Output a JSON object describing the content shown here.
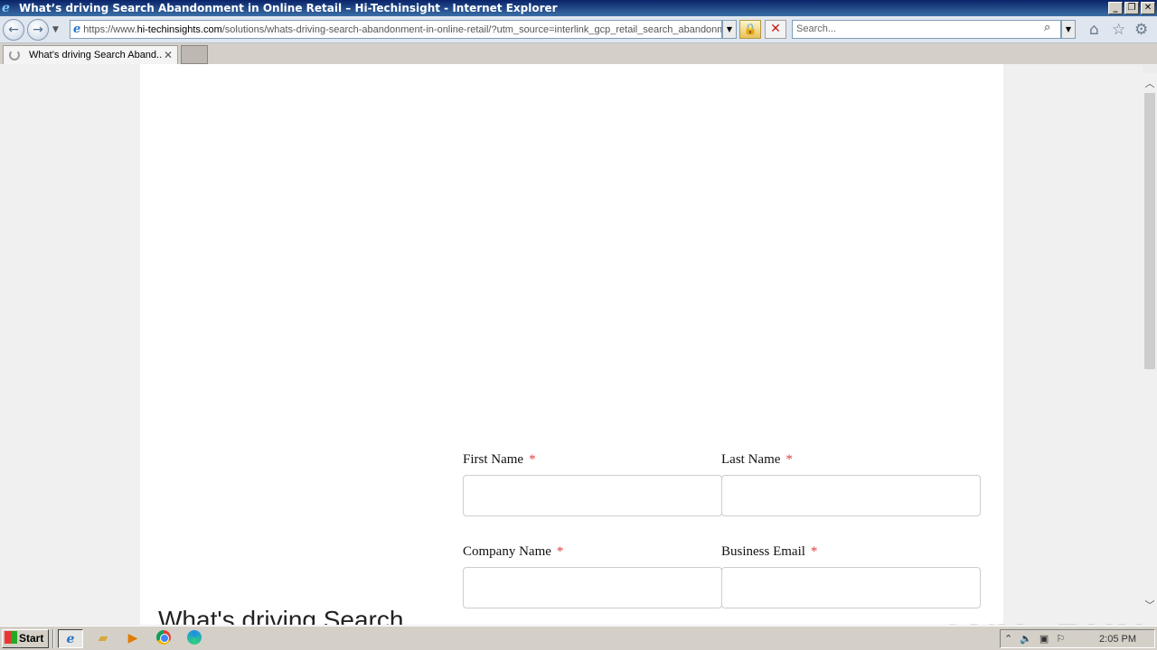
{
  "window": {
    "title": "What’s driving Search Abandonment in Online Retail – Hi-Techinsight - Internet Explorer",
    "minimize": "_",
    "restore": "❐",
    "close": "✕"
  },
  "navbar": {
    "url_prefix": "https://www.",
    "url_host": "hi-techinsights.com",
    "url_path": "/solutions/whats-driving-search-abandonment-in-online-retail/?utm_source=interlink_gcp_retail_search_abandonment",
    "search_placeholder": "Search..."
  },
  "tabs": [
    {
      "label": "What’s driving Search Aband..."
    }
  ],
  "form": {
    "first_name_label": "First Name",
    "last_name_label": "Last Name",
    "company_name_label": "Company Name",
    "business_email_label": "Business Email",
    "required_marker": "*"
  },
  "page": {
    "headline": "What's driving Search"
  },
  "watermark": "ANY▷RUN",
  "taskbar": {
    "start_label": "Start",
    "clock": "2:05 PM"
  },
  "colors": {
    "required": "#e04040",
    "titlebar_start": "#0a246a",
    "titlebar_end": "#3a6ea5"
  }
}
